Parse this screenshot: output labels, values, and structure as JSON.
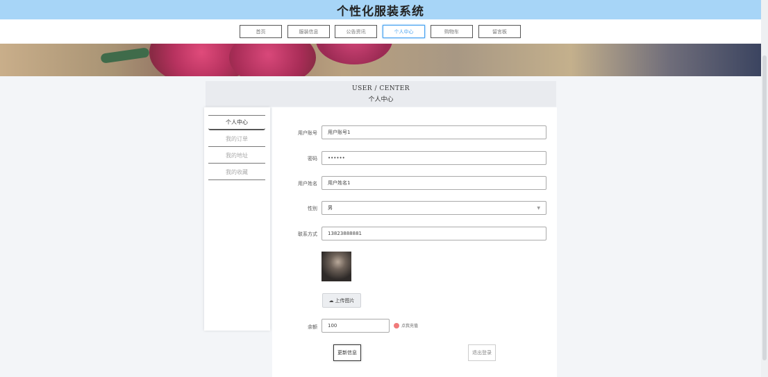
{
  "header": {
    "site_title": "个性化服装系统"
  },
  "nav": {
    "items": [
      {
        "label": "首页"
      },
      {
        "label": "服装信息"
      },
      {
        "label": "公告资讯"
      },
      {
        "label": "个人中心"
      },
      {
        "label": "购物车"
      },
      {
        "label": "留言板"
      }
    ],
    "active_index": 3
  },
  "center": {
    "title_en": "USER / CENTER",
    "title_cn": "个人中心"
  },
  "sidebar": {
    "items": [
      {
        "label": "个人中心"
      },
      {
        "label": "我的订单"
      },
      {
        "label": "我的地址"
      },
      {
        "label": "我的收藏"
      }
    ]
  },
  "form": {
    "account": {
      "label": "用户账号",
      "value": "用户账号1"
    },
    "password": {
      "label": "密码",
      "value": "••••••"
    },
    "name": {
      "label": "用户姓名",
      "value": "用户姓名1"
    },
    "gender": {
      "label": "性别",
      "value": "男"
    },
    "phone": {
      "label": "联系方式",
      "value": "13823888881"
    },
    "upload_label": "上传图片",
    "balance": {
      "label": "余额",
      "value": "100"
    },
    "recharge_label": "点我充值",
    "update_button": "更新信息",
    "logout_button": "退出登录"
  },
  "colors": {
    "topbar": "#a7d5f7",
    "active_nav": "#4aa3f0"
  }
}
